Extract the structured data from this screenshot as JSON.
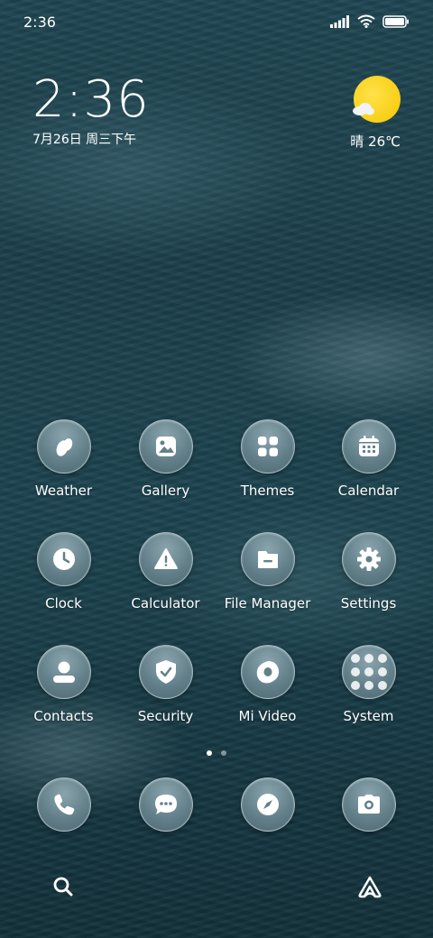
{
  "status_bar": {
    "time": "2:36"
  },
  "clock_widget": {
    "time": "2:36",
    "date": "7月26日 周三下午"
  },
  "weather_widget": {
    "text": "晴 26℃",
    "icon": "sunny-cloud-icon"
  },
  "apps": [
    {
      "label": "Weather",
      "icon": "weather-icon"
    },
    {
      "label": "Gallery",
      "icon": "gallery-icon"
    },
    {
      "label": "Themes",
      "icon": "themes-icon"
    },
    {
      "label": "Calendar",
      "icon": "calendar-icon"
    },
    {
      "label": "Clock",
      "icon": "clock-icon"
    },
    {
      "label": "Calculator",
      "icon": "calculator-icon"
    },
    {
      "label": "File Manager",
      "icon": "folder-icon"
    },
    {
      "label": "Settings",
      "icon": "gear-icon"
    },
    {
      "label": "Contacts",
      "icon": "person-icon"
    },
    {
      "label": "Security",
      "icon": "shield-icon"
    },
    {
      "label": "Mi Video",
      "icon": "video-icon"
    },
    {
      "label": "System",
      "icon": "folder-grid-icon"
    }
  ],
  "dock": [
    {
      "icon": "phone-icon"
    },
    {
      "icon": "message-icon"
    },
    {
      "icon": "compass-icon"
    },
    {
      "icon": "camera-icon"
    }
  ],
  "pages": {
    "current": 1,
    "total": 2
  },
  "colors": {
    "sun": "#f6c700",
    "icon_bg": "#63808a"
  }
}
